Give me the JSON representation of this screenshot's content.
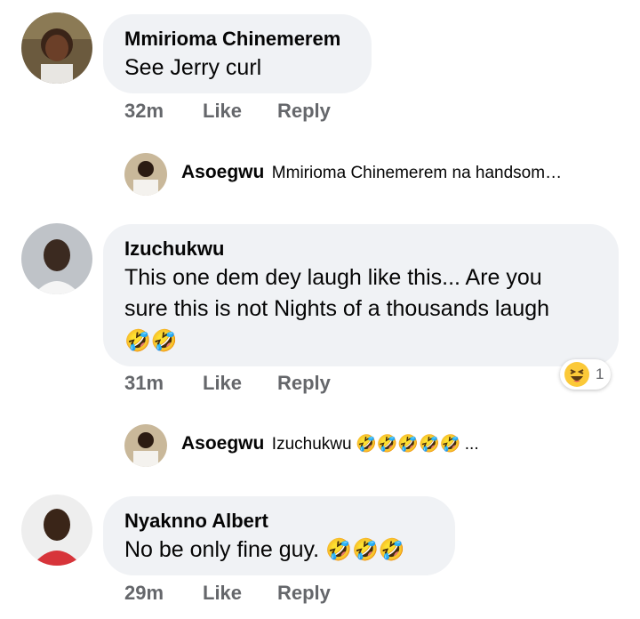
{
  "comments": [
    {
      "author": "Mmirioma Chinemerem",
      "text": "See Jerry curl",
      "time": "32m",
      "like": "Like",
      "reply": "Reply",
      "reply_preview": {
        "author": "Asoegwu",
        "text": "Mmirioma Chinemerem na handsom…"
      }
    },
    {
      "author": "Izuchukwu",
      "text_line1": "This one dem dey laugh like this... Are you",
      "text_line2": "sure this is not Nights of a thousands laugh",
      "emoji_line": "🤣🤣",
      "time": "31m",
      "like": "Like",
      "reply": "Reply",
      "reaction": {
        "icon": "laughing-face-icon",
        "count": "1"
      },
      "reply_preview": {
        "author": "Asoegwu",
        "text": "Izuchukwu",
        "emoji": "🤣🤣🤣🤣🤣",
        "ellipsis": "..."
      }
    },
    {
      "author": "Nyaknno Albert",
      "text": "No be only fine guy.",
      "emoji": "🤣🤣🤣",
      "time": "29m",
      "like": "Like",
      "reply": "Reply"
    }
  ],
  "colors": {
    "bubble": "#f0f2f5",
    "meta": "#65676b",
    "text": "#050505",
    "emoji_face": "#fbc938"
  }
}
